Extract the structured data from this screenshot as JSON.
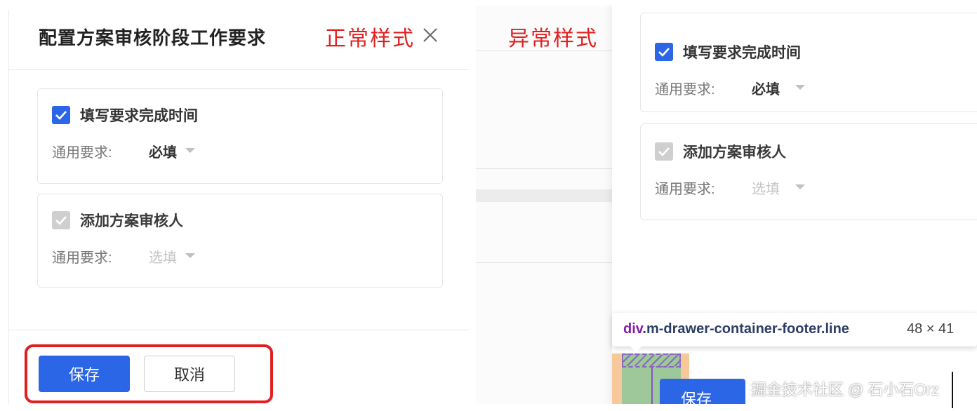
{
  "left": {
    "title": "配置方案审核阶段工作要求",
    "tag": "正常样式",
    "cards": [
      {
        "title": "填写要求完成时间",
        "req_label": "通用要求:",
        "req_value": "必填"
      },
      {
        "title": "添加方案审核人",
        "req_label": "通用要求:",
        "req_value": "选填"
      }
    ],
    "save_label": "保存",
    "cancel_label": "取消"
  },
  "right": {
    "tag": "异常样式",
    "cards": [
      {
        "title": "填写要求完成时间",
        "req_label": "通用要求:",
        "req_value": "必填"
      },
      {
        "title": "添加方案审核人",
        "req_label": "通用要求:",
        "req_value": "选填"
      }
    ],
    "tooltip_tag": "div",
    "tooltip_class": ".m-drawer-container-footer.line",
    "tooltip_size": "48 × 41",
    "save_label": "保存"
  },
  "watermark": "掘金技术社区 @ 石小石Orz",
  "colors": {
    "primary": "#2b66e6",
    "annotation_red": "#e02020",
    "selector_purple": "#8a1aa8"
  }
}
